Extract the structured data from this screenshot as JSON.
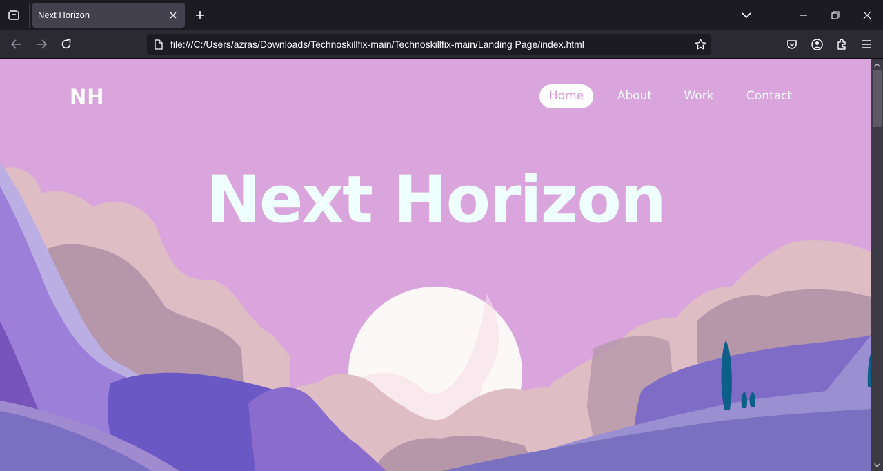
{
  "browser": {
    "tab": {
      "title": "Next Horizon"
    },
    "address": {
      "url": "file:///C:/Users/azras/Downloads/Technoskillfix-main/Technoskillfix-main/Landing Page/index.html"
    },
    "icons": {
      "tab_overview": "tab-overview-icon",
      "tab_close": "close-icon",
      "new_tab": "plus-icon",
      "tab_list": "chevron-down-icon",
      "minimize": "minimize-icon",
      "restore": "restore-icon",
      "close_window": "close-window-icon",
      "back": "back-arrow-icon",
      "forward": "forward-arrow-icon",
      "reload": "reload-icon",
      "page": "page-icon",
      "bookmark": "star-icon",
      "pocket": "pocket-icon",
      "account": "account-icon",
      "extensions": "extensions-icon",
      "menu": "hamburger-menu-icon"
    }
  },
  "page": {
    "logo": "NH",
    "nav": [
      {
        "label": "Home",
        "active": true
      },
      {
        "label": "About",
        "active": false
      },
      {
        "label": "Work",
        "active": false
      },
      {
        "label": "Contact",
        "active": false
      }
    ],
    "hero_title": "Next Horizon"
  },
  "colors": {
    "sky": "#daa5dd",
    "hero_text": "#effffe",
    "active_nav_text": "#d79ed8",
    "sun": "#fdf8f8",
    "clouds": "#debdc4",
    "clouds_shadow": "#b597a9",
    "hills_purple": "#7f63c9",
    "hills_light": "#9a8fd0",
    "trees": "#0e5e8a"
  }
}
